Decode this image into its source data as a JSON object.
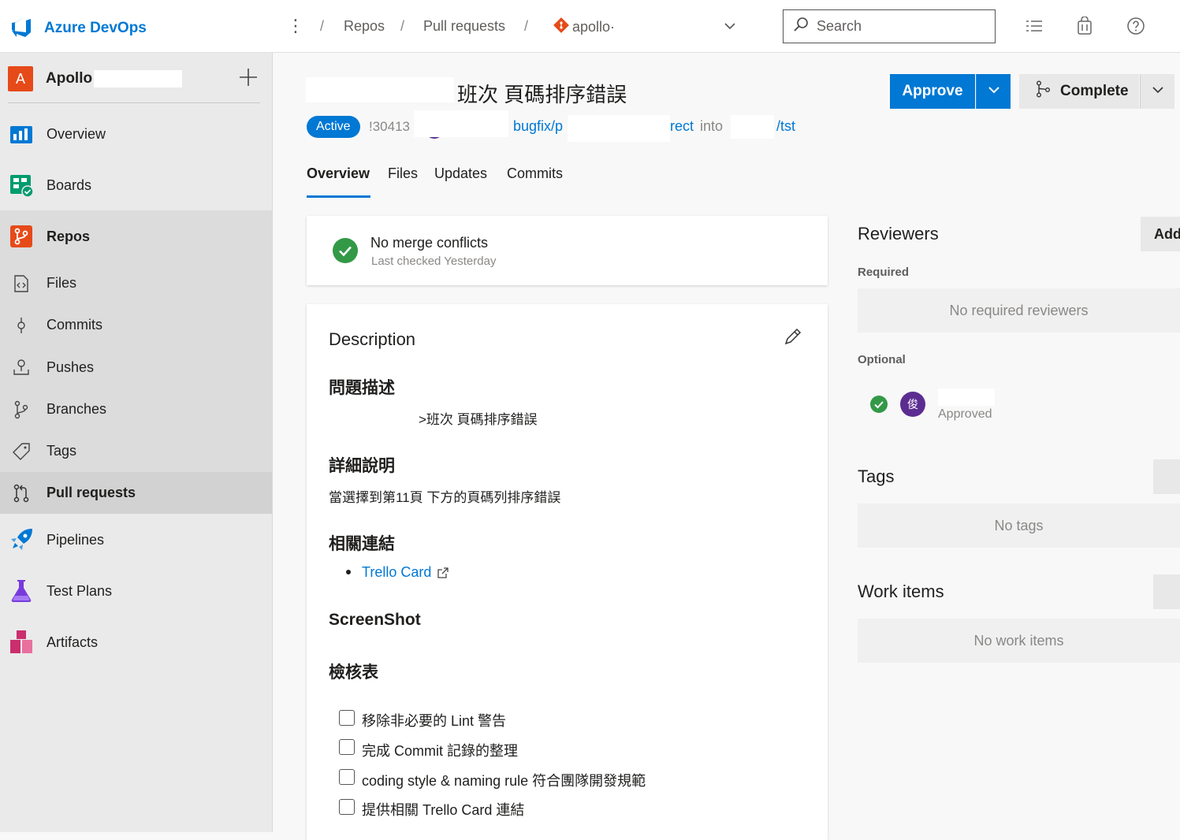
{
  "app": {
    "brand": "Azure DevOps"
  },
  "breadcrumb": {
    "repos": "Repos",
    "pull_requests": "Pull requests",
    "repo_name": "apollo·"
  },
  "search": {
    "placeholder": "Search"
  },
  "project": {
    "initial": "A",
    "name": "Apollo"
  },
  "nav": {
    "overview": "Overview",
    "boards": "Boards",
    "repos": "Repos",
    "files": "Files",
    "commits": "Commits",
    "pushes": "Pushes",
    "branches": "Branches",
    "tags": "Tags",
    "pull_requests": "Pull requests",
    "pipelines": "Pipelines",
    "test_plans": "Test Plans",
    "artifacts": "Artifacts"
  },
  "pr": {
    "title": "班次 頁碼排序錯誤",
    "status": "Active",
    "id": "!30413",
    "source_branch": "bugfix/p",
    "source_branch_tail": "rect",
    "into": "into",
    "target_branch": "/tst",
    "approve_label": "Approve",
    "complete_label": "Complete"
  },
  "tabs": [
    "Overview",
    "Files",
    "Updates",
    "Commits"
  ],
  "merge": {
    "title": "No merge conflicts",
    "subtitle": "Last checked Yesterday"
  },
  "description": {
    "title": "Description",
    "problem_heading": "問題描述",
    "problem_text": ">班次 頁碼排序錯誤",
    "detail_heading": "詳細說明",
    "detail_text": "當選擇到第11頁 下方的頁碼列排序錯誤",
    "links_heading": "相關連結",
    "link_text": "Trello Card",
    "screenshot_heading": "ScreenShot",
    "checklist_heading": "檢核表",
    "checklist": [
      "移除非必要的 Lint 警告",
      "完成 Commit 記錄的整理",
      "coding style & naming rule 符合團隊開發規範",
      "提供相關 Trello Card 連結"
    ]
  },
  "reviewers": {
    "title": "Reviewers",
    "add_label": "Add",
    "required_label": "Required",
    "required_empty": "No required reviewers",
    "optional_label": "Optional",
    "reviewer_initial": "俊",
    "reviewer_status": "Approved"
  },
  "tags": {
    "title": "Tags",
    "empty": "No tags"
  },
  "work_items": {
    "title": "Work items",
    "empty": "No work items"
  },
  "colors": {
    "accent": "#0078d4",
    "success": "#339947",
    "project": "#e64a19"
  }
}
